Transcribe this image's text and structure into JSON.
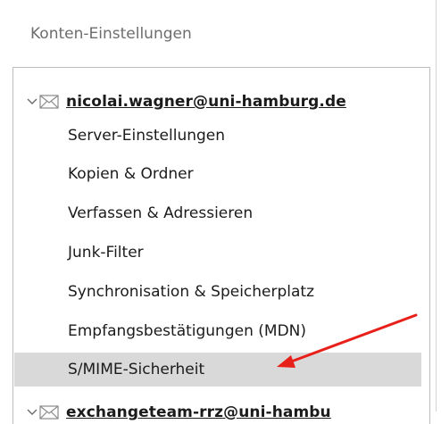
{
  "dialog": {
    "title": "Konten-Einstellungen"
  },
  "accounts": [
    {
      "label": "nicolai.wagner@uni-hamburg.de",
      "expanded": true,
      "icon": "envelope-icon",
      "items": [
        {
          "label": "Server-Einstellungen",
          "selected": false
        },
        {
          "label": "Kopien & Ordner",
          "selected": false
        },
        {
          "label": "Verfassen & Adressieren",
          "selected": false
        },
        {
          "label": "Junk-Filter",
          "selected": false
        },
        {
          "label": "Synchronisation & Speicherplatz",
          "selected": false
        },
        {
          "label": "Empfangsbestätigungen (MDN)",
          "selected": false
        },
        {
          "label": "S/MIME-Sicherheit",
          "selected": true
        }
      ]
    },
    {
      "label": "exchangeteam-rrz@uni-hambu",
      "expanded": true,
      "icon": "envelope-icon"
    }
  ],
  "colors": {
    "selected_bg": "#d9d9d9",
    "annotation_arrow": "#e8201a",
    "title_text": "#6d6d6d"
  }
}
